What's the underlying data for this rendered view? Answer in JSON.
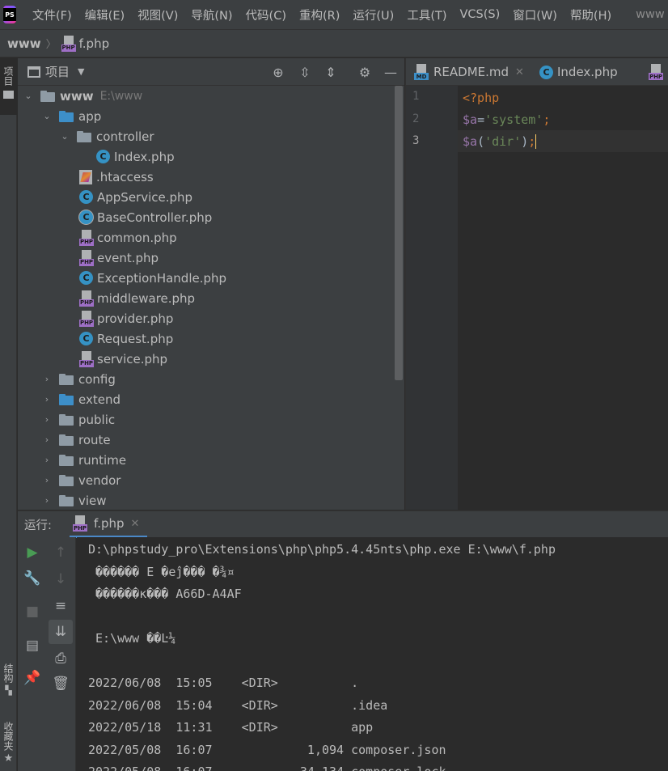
{
  "app": {
    "logo_text": "PS",
    "project_name": "www"
  },
  "menu": [
    "文件(F)",
    "编辑(E)",
    "视图(V)",
    "导航(N)",
    "代码(C)",
    "重构(R)",
    "运行(U)",
    "工具(T)",
    "VCS(S)",
    "窗口(W)",
    "帮助(H)"
  ],
  "breadcrumb": {
    "root": "www",
    "file": "f.php"
  },
  "left_strip": {
    "project": "项目",
    "structure": "结构",
    "favorites": "收藏夹"
  },
  "project_panel": {
    "title": "项目",
    "tree": [
      {
        "label": "www",
        "hint": "E:\\www",
        "kind": "folder",
        "expanded": true
      },
      {
        "label": "app",
        "kind": "folder",
        "expanded": true
      },
      {
        "label": "controller",
        "kind": "folder",
        "expanded": true
      },
      {
        "label": "Index.php",
        "kind": "class"
      },
      {
        "label": ".htaccess",
        "kind": "htaccess"
      },
      {
        "label": "AppService.php",
        "kind": "class"
      },
      {
        "label": "BaseController.php",
        "kind": "class"
      },
      {
        "label": "common.php",
        "kind": "php"
      },
      {
        "label": "event.php",
        "kind": "php"
      },
      {
        "label": "ExceptionHandle.php",
        "kind": "class"
      },
      {
        "label": "middleware.php",
        "kind": "php"
      },
      {
        "label": "provider.php",
        "kind": "php"
      },
      {
        "label": "Request.php",
        "kind": "class"
      },
      {
        "label": "service.php",
        "kind": "php"
      },
      {
        "label": "config",
        "kind": "folder"
      },
      {
        "label": "extend",
        "kind": "folder"
      },
      {
        "label": "public",
        "kind": "folder"
      },
      {
        "label": "route",
        "kind": "folder"
      },
      {
        "label": "runtime",
        "kind": "folder"
      },
      {
        "label": "vendor",
        "kind": "folder"
      },
      {
        "label": "view",
        "kind": "folder"
      }
    ]
  },
  "editor": {
    "tabs": [
      {
        "label": "README.md",
        "icon": "md"
      },
      {
        "label": "Index.php",
        "icon": "class"
      }
    ],
    "line_numbers": [
      "1",
      "2",
      "3"
    ],
    "code": {
      "l1": "<?php",
      "l2_var": "$a",
      "l2_eq": "=",
      "l2_str": "'system'",
      "l2_semi": ";",
      "l3_var": "$a",
      "l3_open": "(",
      "l3_str": "'dir'",
      "l3_close": ")",
      "l3_semi": ";"
    }
  },
  "run": {
    "label": "运行:",
    "tab": "f.php",
    "console": [
      "D:\\phpstudy_pro\\Extensions\\php\\php5.4.45nts\\php.exe E:\\www\\f.php",
      " ������ E �еĵ��� �¾¤",
      " ������к��� A66D-A4AF",
      "",
      " E:\\www ��Ŀ¼",
      "",
      "2022/06/08  15:05    <DIR>          .",
      "2022/06/08  15:04    <DIR>          .idea",
      "2022/05/18  11:31    <DIR>          app",
      "2022/05/08  16:07             1,094 composer.json",
      "2022/05/08  16:07            34,134 composer.lock"
    ]
  },
  "colors": {
    "accent": "#4a88c7",
    "php_purple": "#9e6fc6",
    "class_blue": "#3592c4",
    "folder_blue": "#3d8fc9",
    "run_green": "#499c54"
  }
}
